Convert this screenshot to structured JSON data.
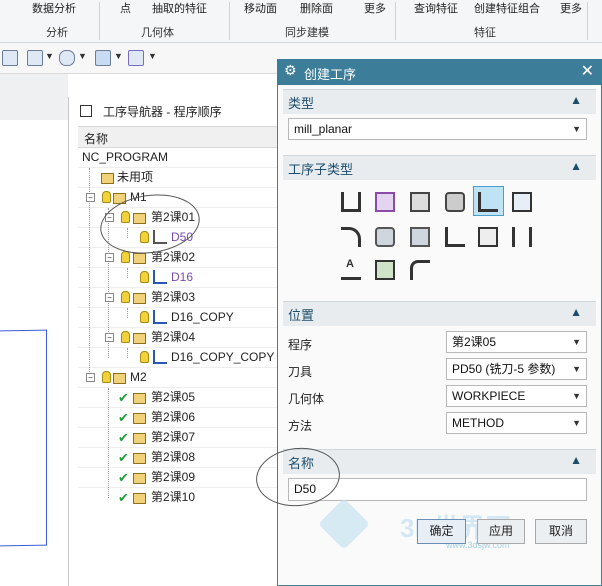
{
  "ribbon": {
    "groups": [
      "分析",
      "几何体",
      "同步建模",
      "特征"
    ],
    "top_fragments": [
      "数据分析",
      "点",
      "抽取的特征",
      "移动面",
      "删除面",
      "更多",
      "查询特征",
      "创建特征组合"
    ],
    "more": "更多"
  },
  "navigator": {
    "title": "工序导航器 - 程序顺序",
    "column_header": "名称",
    "rows": [
      {
        "label": "NC_PROGRAM"
      },
      {
        "label": "未用项"
      },
      {
        "label": "M1"
      },
      {
        "label": "第2课01"
      },
      {
        "label": "D50"
      },
      {
        "label": "第2课02"
      },
      {
        "label": "D16"
      },
      {
        "label": "第2课03"
      },
      {
        "label": "D16_COPY"
      },
      {
        "label": "第2课04"
      },
      {
        "label": "D16_COPY_COPY"
      },
      {
        "label": "M2"
      },
      {
        "label": "第2课05"
      },
      {
        "label": "第2课06"
      },
      {
        "label": "第2课07"
      },
      {
        "label": "第2课08"
      },
      {
        "label": "第2课09"
      },
      {
        "label": "第2课10"
      }
    ]
  },
  "dialog": {
    "title": "创建工序",
    "type": {
      "label": "类型",
      "value": "mill_planar"
    },
    "subtype": {
      "label": "工序子类型"
    },
    "location": {
      "label": "位置",
      "fields": [
        {
          "label": "程序",
          "value": "第2课05"
        },
        {
          "label": "刀具",
          "value": "PD50 (铣刀-5 参数)"
        },
        {
          "label": "几何体",
          "value": "WORKPIECE"
        },
        {
          "label": "方法",
          "value": "METHOD"
        }
      ]
    },
    "name": {
      "label": "名称",
      "value": "D50"
    },
    "buttons": {
      "ok": "确定",
      "apply": "应用",
      "cancel": "取消"
    }
  },
  "watermark": {
    "text": "3D世界网",
    "url": "www.3dsjw.com"
  },
  "colors": {
    "dialog_title_bg": "#3c7d99",
    "check": "#1f9e3a",
    "purple_text": "#7c4bb0",
    "part_edge": "#3a5bd9"
  }
}
